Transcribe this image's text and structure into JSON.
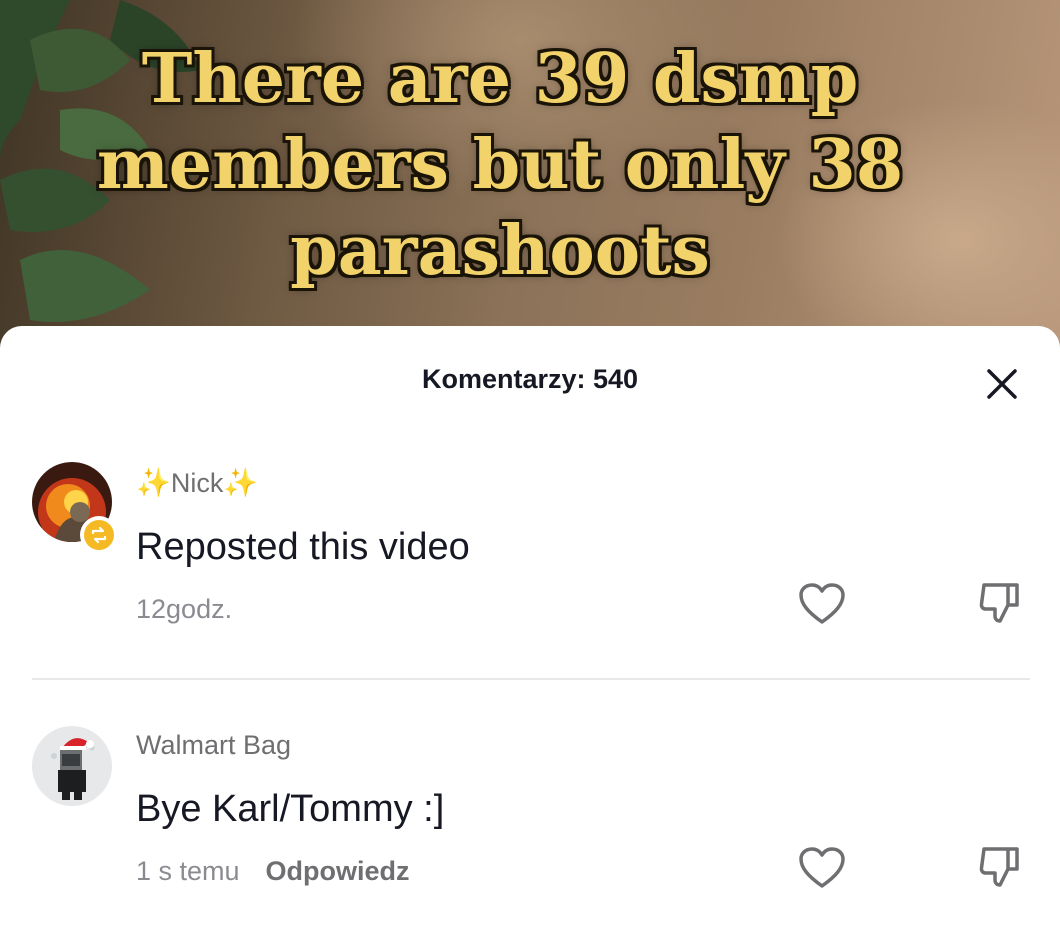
{
  "video": {
    "caption_lines": [
      "There are 39 dsmp",
      "members but only 38",
      "parashoots"
    ]
  },
  "comments_sheet": {
    "title": "Komentarzy: 540",
    "close_icon": "close-icon",
    "comments": [
      {
        "sparkle_left": "✨",
        "username": "Nick",
        "sparkle_right": "✨",
        "text": "Reposted this video",
        "time": "12godz.",
        "reply_label": "",
        "badge_icon": "repost-icon"
      },
      {
        "username": "Walmart Bag",
        "text": "Bye Karl/Tommy :]",
        "time": "1 s temu",
        "reply_label": "Odpowiedz"
      }
    ]
  },
  "colors": {
    "caption_fill": "#f2d26a",
    "caption_outline": "#1a1408",
    "repost_badge": "#f5b923",
    "text_primary": "#161823",
    "text_secondary": "#8a8b91"
  }
}
